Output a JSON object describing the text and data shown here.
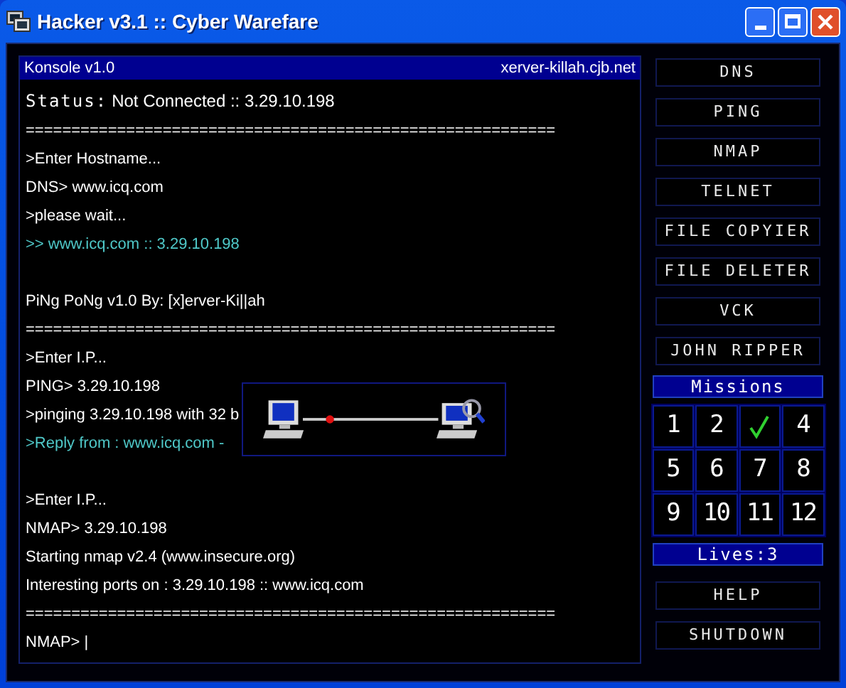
{
  "window": {
    "title": "Hacker v3.1 :: Cyber Warefare"
  },
  "console": {
    "title": "Konsole v1.0",
    "site": "xerver-killah.cjb.net",
    "status": {
      "label": "Status:",
      "value": "Not Connected :: 3.29.10.198"
    },
    "lines": [
      {
        "kind": "text",
        "text": "=========================================================="
      },
      {
        "kind": "text",
        "text": ">Enter Hostname..."
      },
      {
        "kind": "text",
        "text": "DNS> www.icq.com"
      },
      {
        "kind": "text",
        "text": ">please wait..."
      },
      {
        "kind": "reply",
        "text": ">> www.icq.com :: 3.29.10.198"
      },
      {
        "kind": "blank"
      },
      {
        "kind": "text",
        "text": "PiNg PoNg v1.0 By: [x]erver-Ki||ah"
      },
      {
        "kind": "text",
        "text": "=========================================================="
      },
      {
        "kind": "text",
        "text": ">Enter I.P..."
      },
      {
        "kind": "text",
        "text": "PING> 3.29.10.198"
      },
      {
        "kind": "text",
        "text": ">pinging 3.29.10.198 with 32 b"
      },
      {
        "kind": "reply",
        "text": ">Reply from : www.icq.com -"
      },
      {
        "kind": "blank"
      },
      {
        "kind": "text",
        "text": ">Enter I.P..."
      },
      {
        "kind": "text",
        "text": "NMAP> 3.29.10.198"
      },
      {
        "kind": "text",
        "text": "Starting nmap v2.4 (www.insecure.org)"
      },
      {
        "kind": "text",
        "text": "Interesting ports on : 3.29.10.198 :: www.icq.com"
      },
      {
        "kind": "text",
        "text": "=========================================================="
      },
      {
        "kind": "prompt",
        "text": "NMAP> |"
      }
    ]
  },
  "tools": [
    "DNS",
    "PING",
    "NMAP",
    "TELNET",
    "FILE COPYIER",
    "FILE DELETER",
    "VCK",
    "JOHN RIPPER"
  ],
  "missions": {
    "title": "Missions",
    "items": [
      {
        "label": "1",
        "completed": false
      },
      {
        "label": "2",
        "completed": false
      },
      {
        "completed": true
      },
      {
        "label": "4",
        "completed": false
      },
      {
        "label": "5",
        "completed": false
      },
      {
        "label": "6",
        "completed": false
      },
      {
        "label": "7",
        "completed": false
      },
      {
        "label": "8",
        "completed": false
      },
      {
        "label": "9",
        "completed": false
      },
      {
        "label": "10",
        "completed": false
      },
      {
        "label": "11",
        "completed": false
      },
      {
        "label": "12",
        "completed": false
      }
    ]
  },
  "lives": "Lives:3",
  "actions": [
    "HELP",
    "SHUTDOWN"
  ]
}
